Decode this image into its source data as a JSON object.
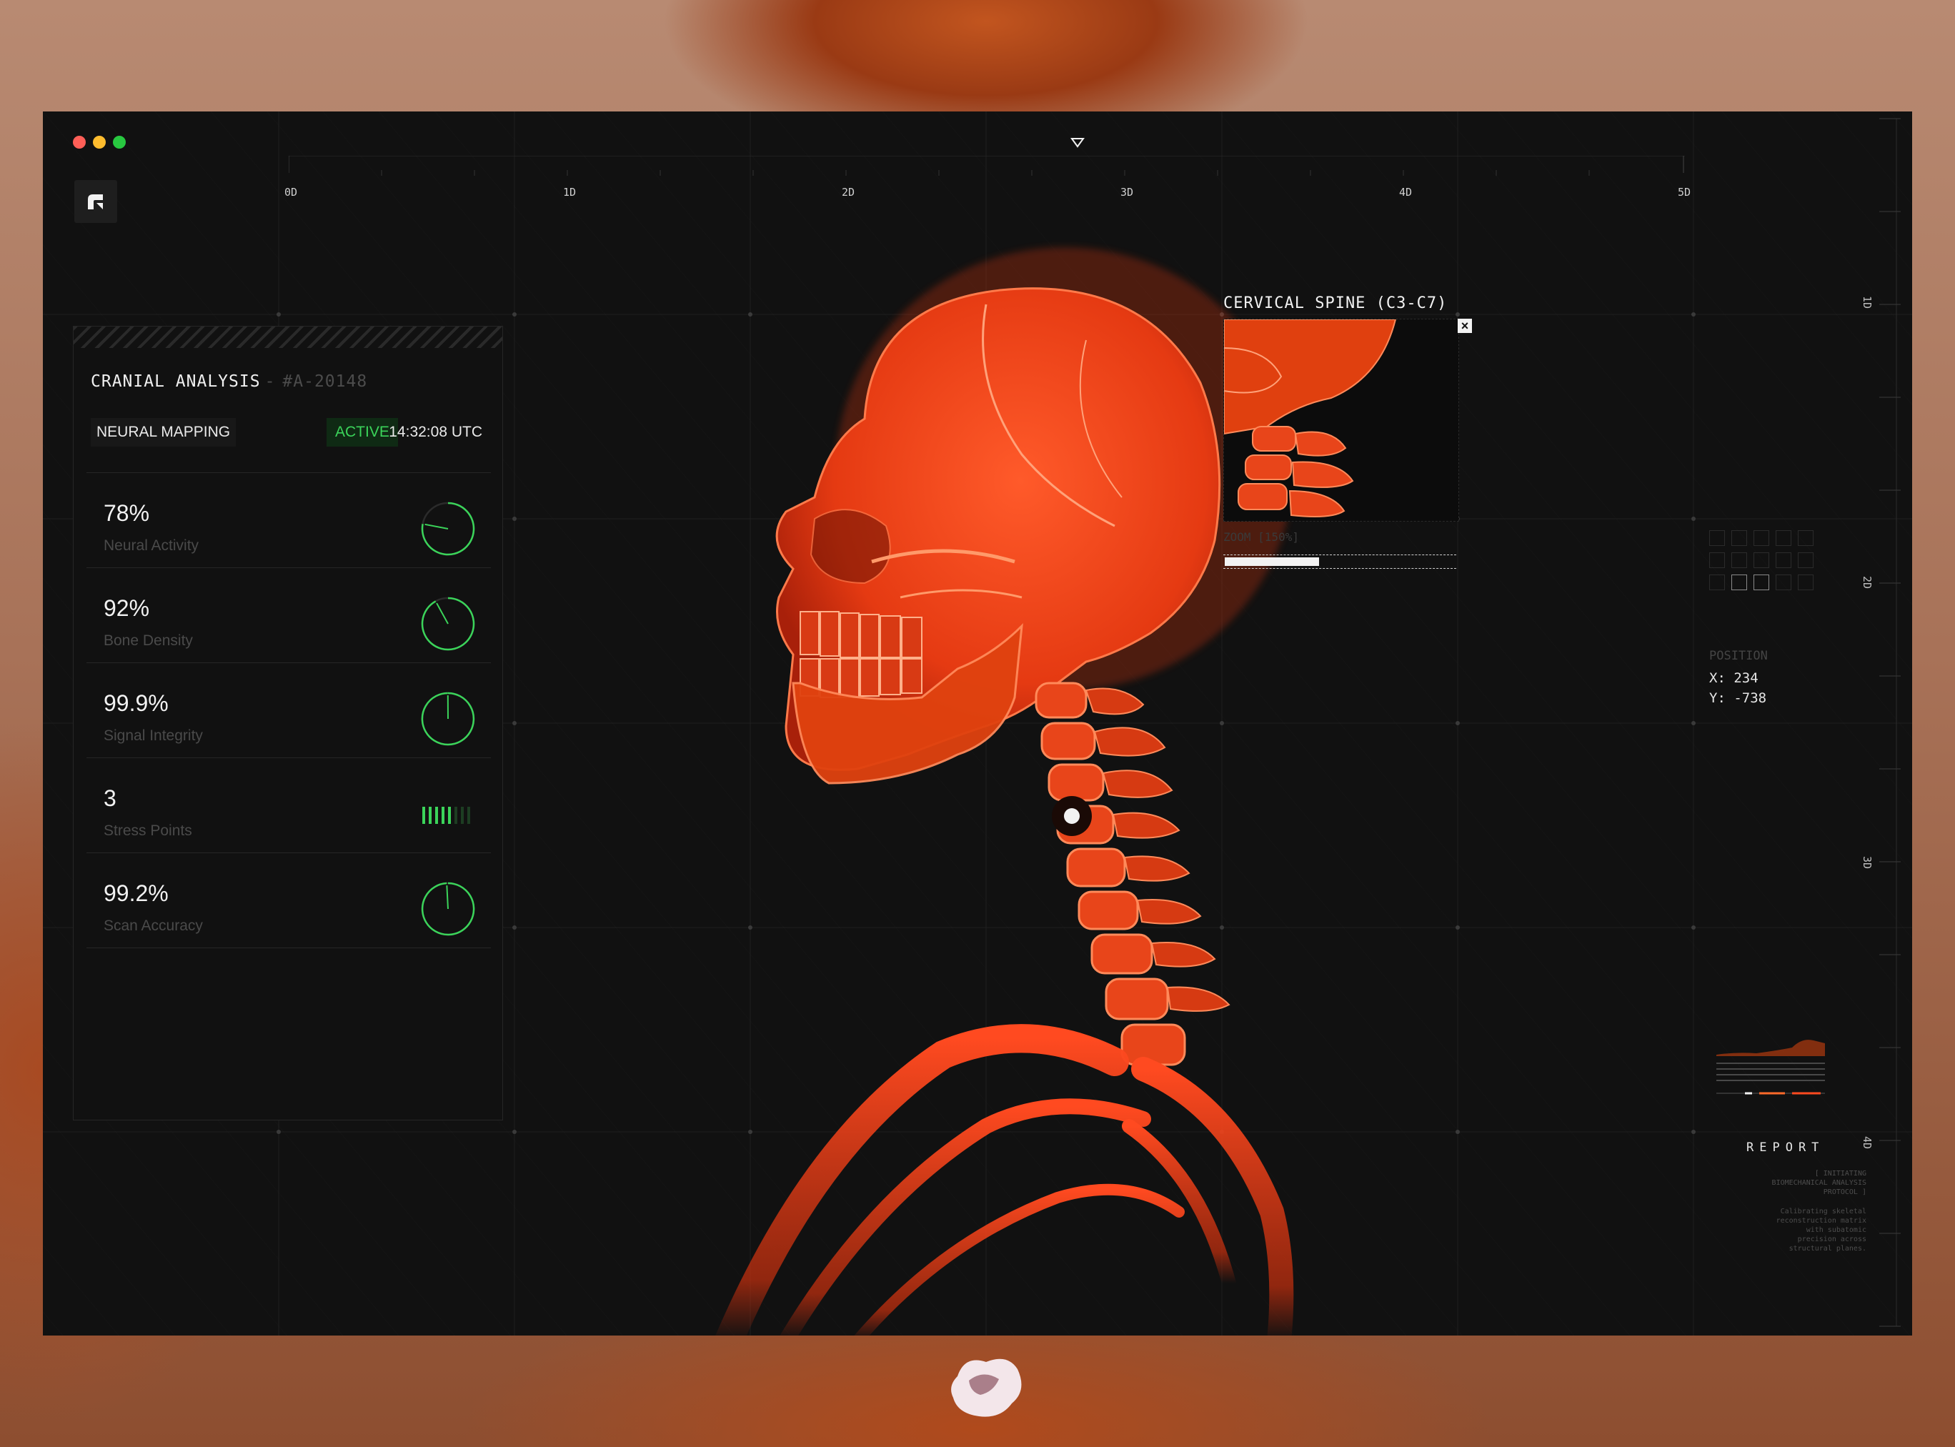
{
  "window": {
    "controls": [
      "close",
      "minimize",
      "maximize"
    ],
    "control_colors": [
      "#ff5f57",
      "#febc2e",
      "#28c840"
    ]
  },
  "ruler_top": {
    "labels": [
      "0D",
      "1D",
      "2D",
      "3D",
      "4D",
      "5D"
    ]
  },
  "ruler_right": {
    "labels": [
      "1D",
      "2D",
      "3D",
      "4D"
    ]
  },
  "panel": {
    "title": "CRANIAL ANALYSIS",
    "separator": "-",
    "id": "#A-20148",
    "mode": "NEURAL MAPPING",
    "status": "ACTIVE",
    "time": "14:32:08 UTC",
    "metrics": [
      {
        "value": "78%",
        "label": "Neural Activity",
        "gauge": 0.78
      },
      {
        "value": "92%",
        "label": "Bone Density",
        "gauge": 0.92
      },
      {
        "value": "99.9%",
        "label": "Signal Integrity",
        "gauge": 0.999
      },
      {
        "value": "3",
        "label": "Stress Points",
        "bars_on": 5,
        "bars_total": 8
      },
      {
        "value": "99.2%",
        "label": "Scan Accuracy",
        "gauge": 0.992
      }
    ]
  },
  "inset": {
    "title": "CERVICAL SPINE (C3-C7)",
    "close_icon": "close-icon",
    "zoom_label": "ZOOM [150%]",
    "zoom_fill": 0.41
  },
  "position": {
    "title": "POSITION",
    "x": "X: 234",
    "y": "Y: -738"
  },
  "report": {
    "title": "REPORT",
    "lines": [
      "[ INITIATING",
      "BIOMECHANICAL ANALYSIS",
      "PROTOCOL ]"
    ],
    "lines2": [
      "Calibrating skeletal",
      "reconstruction matrix",
      "with subatomic",
      "precision across",
      "structural planes."
    ]
  },
  "colors": {
    "accent_green": "#3bd45a",
    "bone": "#ff4a20",
    "background": "#111111"
  }
}
